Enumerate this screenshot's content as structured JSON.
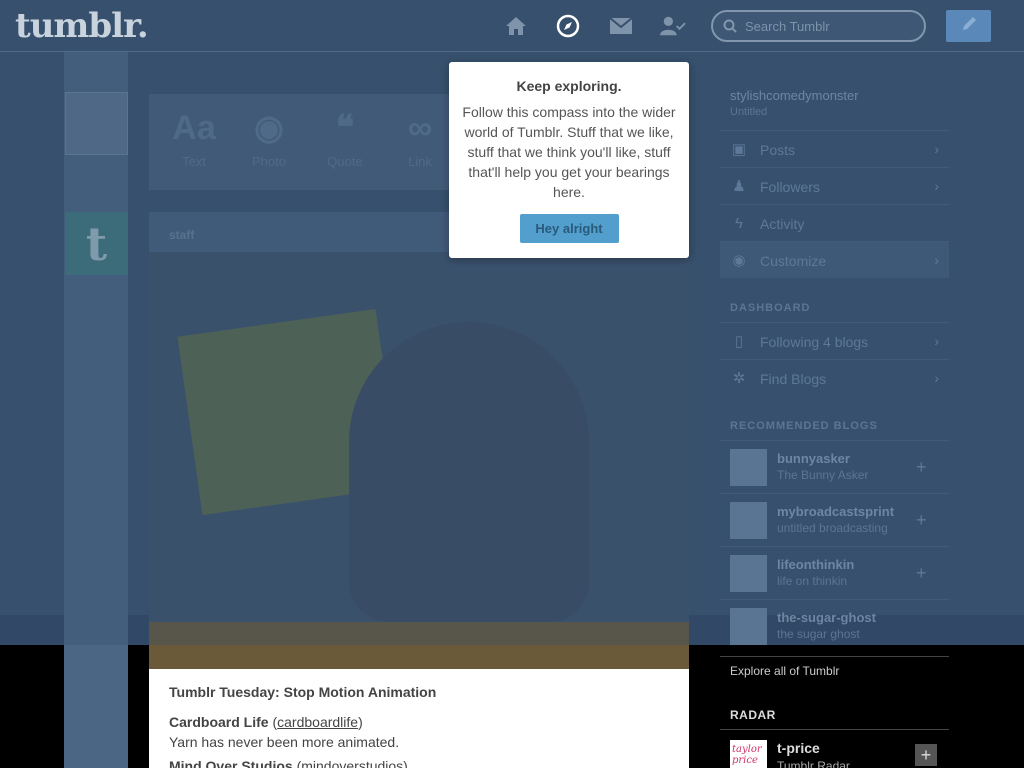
{
  "header": {
    "logo": "tumblr.",
    "search_placeholder": "Search Tumblr",
    "nav": [
      "home-icon",
      "compass-icon",
      "mail-icon",
      "account-icon"
    ]
  },
  "post_types": [
    {
      "label": "Text",
      "glyph": "Aa"
    },
    {
      "label": "Photo",
      "glyph": "◉"
    },
    {
      "label": "Quote",
      "glyph": "❝"
    },
    {
      "label": "Link",
      "glyph": "∞"
    }
  ],
  "post": {
    "user": "staff",
    "title": "Tumblr Tuesday: Stop Motion Animation",
    "entry1_name": "Cardboard Life",
    "entry1_paren_open": "(",
    "entry1_link": "cardboardlife",
    "entry1_paren_close": ")",
    "entry1_desc": "Yarn has never been more animated.",
    "entry2_name": "Mind Over Studios",
    "entry2_link": "(mindoverstudios)"
  },
  "sidebar": {
    "blog_name": "stylishcomedymonster",
    "blog_sub": "Untitled",
    "items": [
      {
        "label": "Posts",
        "icon": "▣"
      },
      {
        "label": "Followers",
        "icon": "♟"
      },
      {
        "label": "Activity",
        "icon": "ϟ"
      },
      {
        "label": "Customize",
        "icon": "◉"
      }
    ],
    "dashboard_heading": "DASHBOARD",
    "dashboard_items": [
      {
        "label": "Following 4 blogs",
        "icon": "▯"
      },
      {
        "label": "Find Blogs",
        "icon": "✲"
      }
    ],
    "recommended_heading": "RECOMMENDED BLOGS",
    "recommended": [
      {
        "name": "bunnyasker",
        "desc": "The Bunny Asker"
      },
      {
        "name": "mybroadcastsprint",
        "desc": "untitled broadcasting"
      },
      {
        "name": "lifeonthinkin",
        "desc": "life on thinkin"
      },
      {
        "name": "the-sugar-ghost",
        "desc": "the sugar ghost"
      }
    ],
    "explore": "Explore all of Tumblr",
    "radar_heading": "RADAR",
    "radar_name": "t-price",
    "radar_sub": "Tumblr Radar",
    "radar_thumb_text": "taylor price"
  },
  "popover": {
    "title": "Keep exploring.",
    "body": "Follow this compass into the wider world of Tumblr. Stuff that we like, stuff that we think you'll like, stuff that'll help you get your bearings here.",
    "button": "Hey alright"
  }
}
